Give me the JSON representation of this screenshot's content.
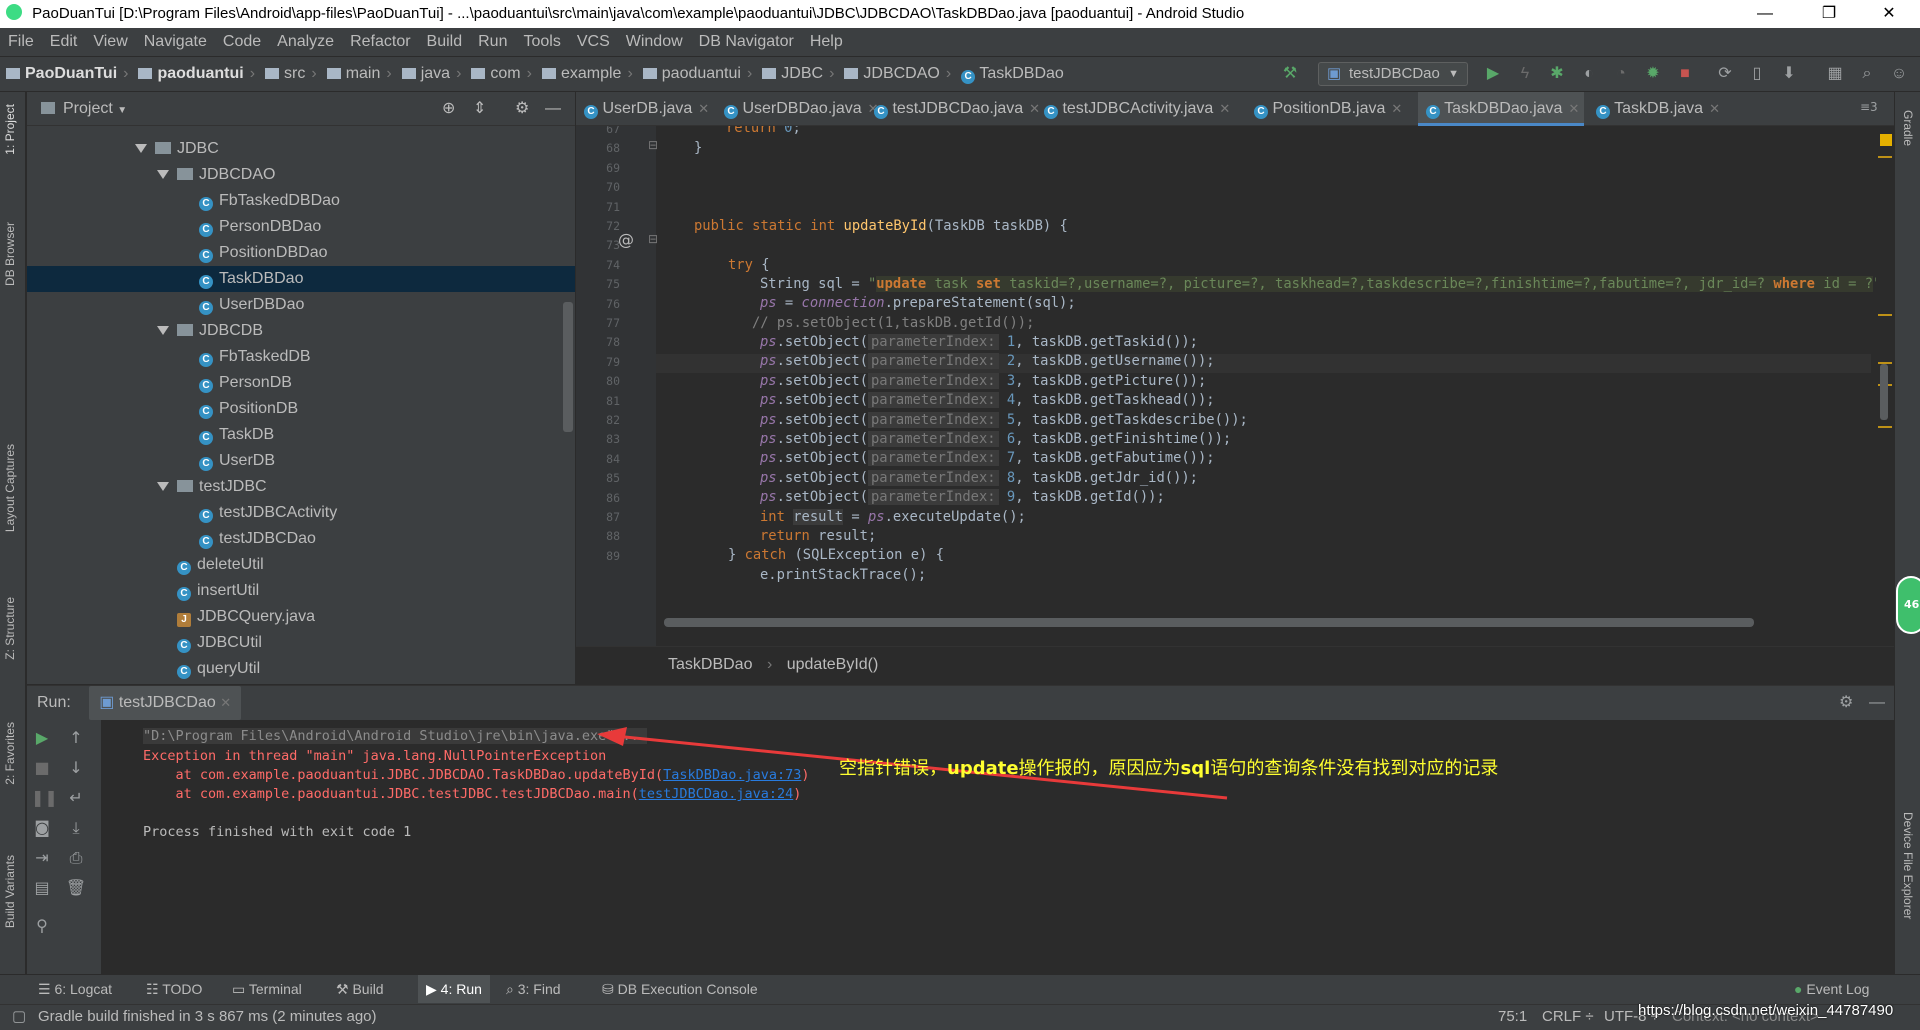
{
  "window": {
    "title": "PaoDuanTui [D:\\Program Files\\Android\\app-files\\PaoDuanTui] - ...\\paoduantui\\src\\main\\java\\com\\example\\paoduantui\\JDBC\\JDBCDAO\\TaskDBDao.java [paoduantui] - Android Studio",
    "minimize": "—",
    "restore": "❐",
    "close": "✕"
  },
  "menu": [
    "File",
    "Edit",
    "View",
    "Navigate",
    "Code",
    "Analyze",
    "Refactor",
    "Build",
    "Run",
    "Tools",
    "VCS",
    "Window",
    "DB Navigator",
    "Help"
  ],
  "breadcrumbs": [
    "PaoDuanTui",
    "paoduantui",
    "src",
    "main",
    "java",
    "com",
    "example",
    "paoduantui",
    "JDBC",
    "JDBCDAO",
    "TaskDBDao"
  ],
  "run_config": "testJDBCDao",
  "left_strip": [
    "1: Project",
    "DB Browser",
    "Layout Captures",
    "Z: Structure",
    "2: Favorites",
    "Build Variants"
  ],
  "right_strip": [
    "Gradle",
    "Device File Explorer"
  ],
  "project": {
    "header": "Project",
    "tree": [
      {
        "label": "JDBC",
        "kind": "folder",
        "depth": 0,
        "expanded": true
      },
      {
        "label": "JDBCDAO",
        "kind": "folder",
        "depth": 1,
        "expanded": true
      },
      {
        "label": "FbTaskedDBDao",
        "kind": "class",
        "depth": 2
      },
      {
        "label": "PersonDBDao",
        "kind": "class",
        "depth": 2
      },
      {
        "label": "PositionDBDao",
        "kind": "class",
        "depth": 2
      },
      {
        "label": "TaskDBDao",
        "kind": "class",
        "depth": 2,
        "selected": true
      },
      {
        "label": "UserDBDao",
        "kind": "class",
        "depth": 2
      },
      {
        "label": "JDBCDB",
        "kind": "folder",
        "depth": 1,
        "expanded": true
      },
      {
        "label": "FbTaskedDB",
        "kind": "class",
        "depth": 2
      },
      {
        "label": "PersonDB",
        "kind": "class",
        "depth": 2
      },
      {
        "label": "PositionDB",
        "kind": "class",
        "depth": 2
      },
      {
        "label": "TaskDB",
        "kind": "class",
        "depth": 2
      },
      {
        "label": "UserDB",
        "kind": "class",
        "depth": 2
      },
      {
        "label": "testJDBC",
        "kind": "folder",
        "depth": 1,
        "expanded": true
      },
      {
        "label": "testJDBCActivity",
        "kind": "class",
        "depth": 2
      },
      {
        "label": "testJDBCDao",
        "kind": "class",
        "depth": 2
      },
      {
        "label": "deleteUtil",
        "kind": "class",
        "depth": 1
      },
      {
        "label": "insertUtil",
        "kind": "class",
        "depth": 1
      },
      {
        "label": "JDBCQuery.java",
        "kind": "file",
        "depth": 1
      },
      {
        "label": "JDBCUtil",
        "kind": "class",
        "depth": 1
      },
      {
        "label": "queryUtil",
        "kind": "class",
        "depth": 1
      }
    ]
  },
  "editor": {
    "tabs": [
      {
        "label": "UserDB.java",
        "active": false
      },
      {
        "label": "UserDBDao.java",
        "active": false
      },
      {
        "label": "testJDBCDao.java",
        "active": false
      },
      {
        "label": "testJDBCActivity.java",
        "active": false
      },
      {
        "label": "PositionDB.java",
        "active": false
      },
      {
        "label": "TaskDBDao.java",
        "active": true
      },
      {
        "label": "TaskDB.java",
        "active": false
      }
    ],
    "tab_overflow": "≡3",
    "line_numbers": [
      "67",
      "68",
      "69",
      "70",
      "71",
      "72",
      "73",
      "74",
      "75",
      "76",
      "77",
      "78",
      "79",
      "80",
      "81",
      "82",
      "83",
      "84",
      "85",
      "86",
      "87",
      "88",
      "89"
    ],
    "code": {
      "l67": "return 0;",
      "l68": "}",
      "l71_kw": "public static int ",
      "l71_fn": "updateById",
      "l71_rest": "(TaskDB taskDB) {",
      "l73_kw": "try",
      "l73_rest": " {",
      "l74_pre": "String sql = ",
      "l74_q": "\"",
      "l74_sql1": "update",
      "l74_mid1": " task ",
      "l74_sql2": "set",
      "l74_mid2": " taskid=?,username=?, picture=?, taskhead=?,taskdescribe=?,finishtime=?,fabutime=?, jdr_id=? ",
      "l74_sql3": "where",
      "l74_mid3": " id = ?",
      "l74_end": "\";",
      "l75_ps": "ps",
      "l75_eq": " = ",
      "l75_conn": "connection",
      "l75_rest": ".prepareStatement(sql);",
      "l76": "// ps.setObject(1,taskDB.getId());",
      "setobj_ps": "ps",
      "setobj_call": ".setObject(",
      "param_hint": "parameterIndex:",
      "set_lines": [
        {
          "idx": "1",
          "getter": "taskDB.getTaskid());"
        },
        {
          "idx": "2",
          "getter": "taskDB.getUsername());"
        },
        {
          "idx": "3",
          "getter": "taskDB.getPicture());"
        },
        {
          "idx": "4",
          "getter": "taskDB.getTaskhead());"
        },
        {
          "idx": "5",
          "getter": "taskDB.getTaskdescribe());"
        },
        {
          "idx": "6",
          "getter": "taskDB.getFinishtime());"
        },
        {
          "idx": "7",
          "getter": "taskDB.getFabutime());"
        },
        {
          "idx": "8",
          "getter": "taskDB.getJdr_id());"
        },
        {
          "idx": "9",
          "getter": "taskDB.getId());"
        }
      ],
      "l86_kw": "int ",
      "l86_var": "result",
      "l86_eq": " = ",
      "l86_ps": "ps",
      "l86_rest": ".executeUpdate();",
      "l87_kw": "return",
      "l87_rest": " result;",
      "l88_pre": "} ",
      "l88_kw": "catch",
      "l88_rest": " (SQLException e) {",
      "l89": "e.printStackTrace();"
    },
    "breadcrumb": [
      "TaskDBDao",
      "updateById()"
    ]
  },
  "run": {
    "label": "Run:",
    "tab": "testJDBCDao",
    "cmd": "\"D:\\Program Files\\Android\\Android Studio\\jre\\bin\\java.exe\" ...",
    "exception": "Exception in thread \"main\" java.lang.NullPointerException",
    "at1_pre": "    at com.example.paoduantui.JDBC.JDBCDAO.TaskDBDao.updateById(",
    "at1_link": "TaskDBDao.java:73",
    "at1_post": ")",
    "at2_pre": "    at com.example.paoduantui.JDBC.testJDBC.testJDBCDao.main(",
    "at2_link": "testJDBCDao.java:24",
    "at2_post": ")",
    "finished": "Process finished with exit code 1"
  },
  "annotation": {
    "part1": "空指针错误，",
    "bold1": "update",
    "part2": "操作报的，原因应为",
    "bold2": "sql",
    "part3": "语句的查询条件没有找到对应的记录",
    "color": "#ffff30"
  },
  "bottom_tabs": [
    "6: Logcat",
    "TODO",
    "Terminal",
    "Build",
    "4: Run",
    "3: Find",
    "DB Execution Console"
  ],
  "event_log": "Event Log",
  "status": {
    "message": "Gradle build finished in 3 s 867 ms (2 minutes ago)",
    "position": "75:1",
    "line_sep": "CRLF ÷",
    "encoding": "UTF-8 ÷",
    "context": "Context: <no context>",
    "watermark": "https://blog.csdn.net/weixin_44787490"
  },
  "side_badge": "46",
  "colors": {
    "accent": "#4a88c7",
    "error": "#ff6b68",
    "run_green": "#59a869",
    "stop_red": "#c75450"
  }
}
